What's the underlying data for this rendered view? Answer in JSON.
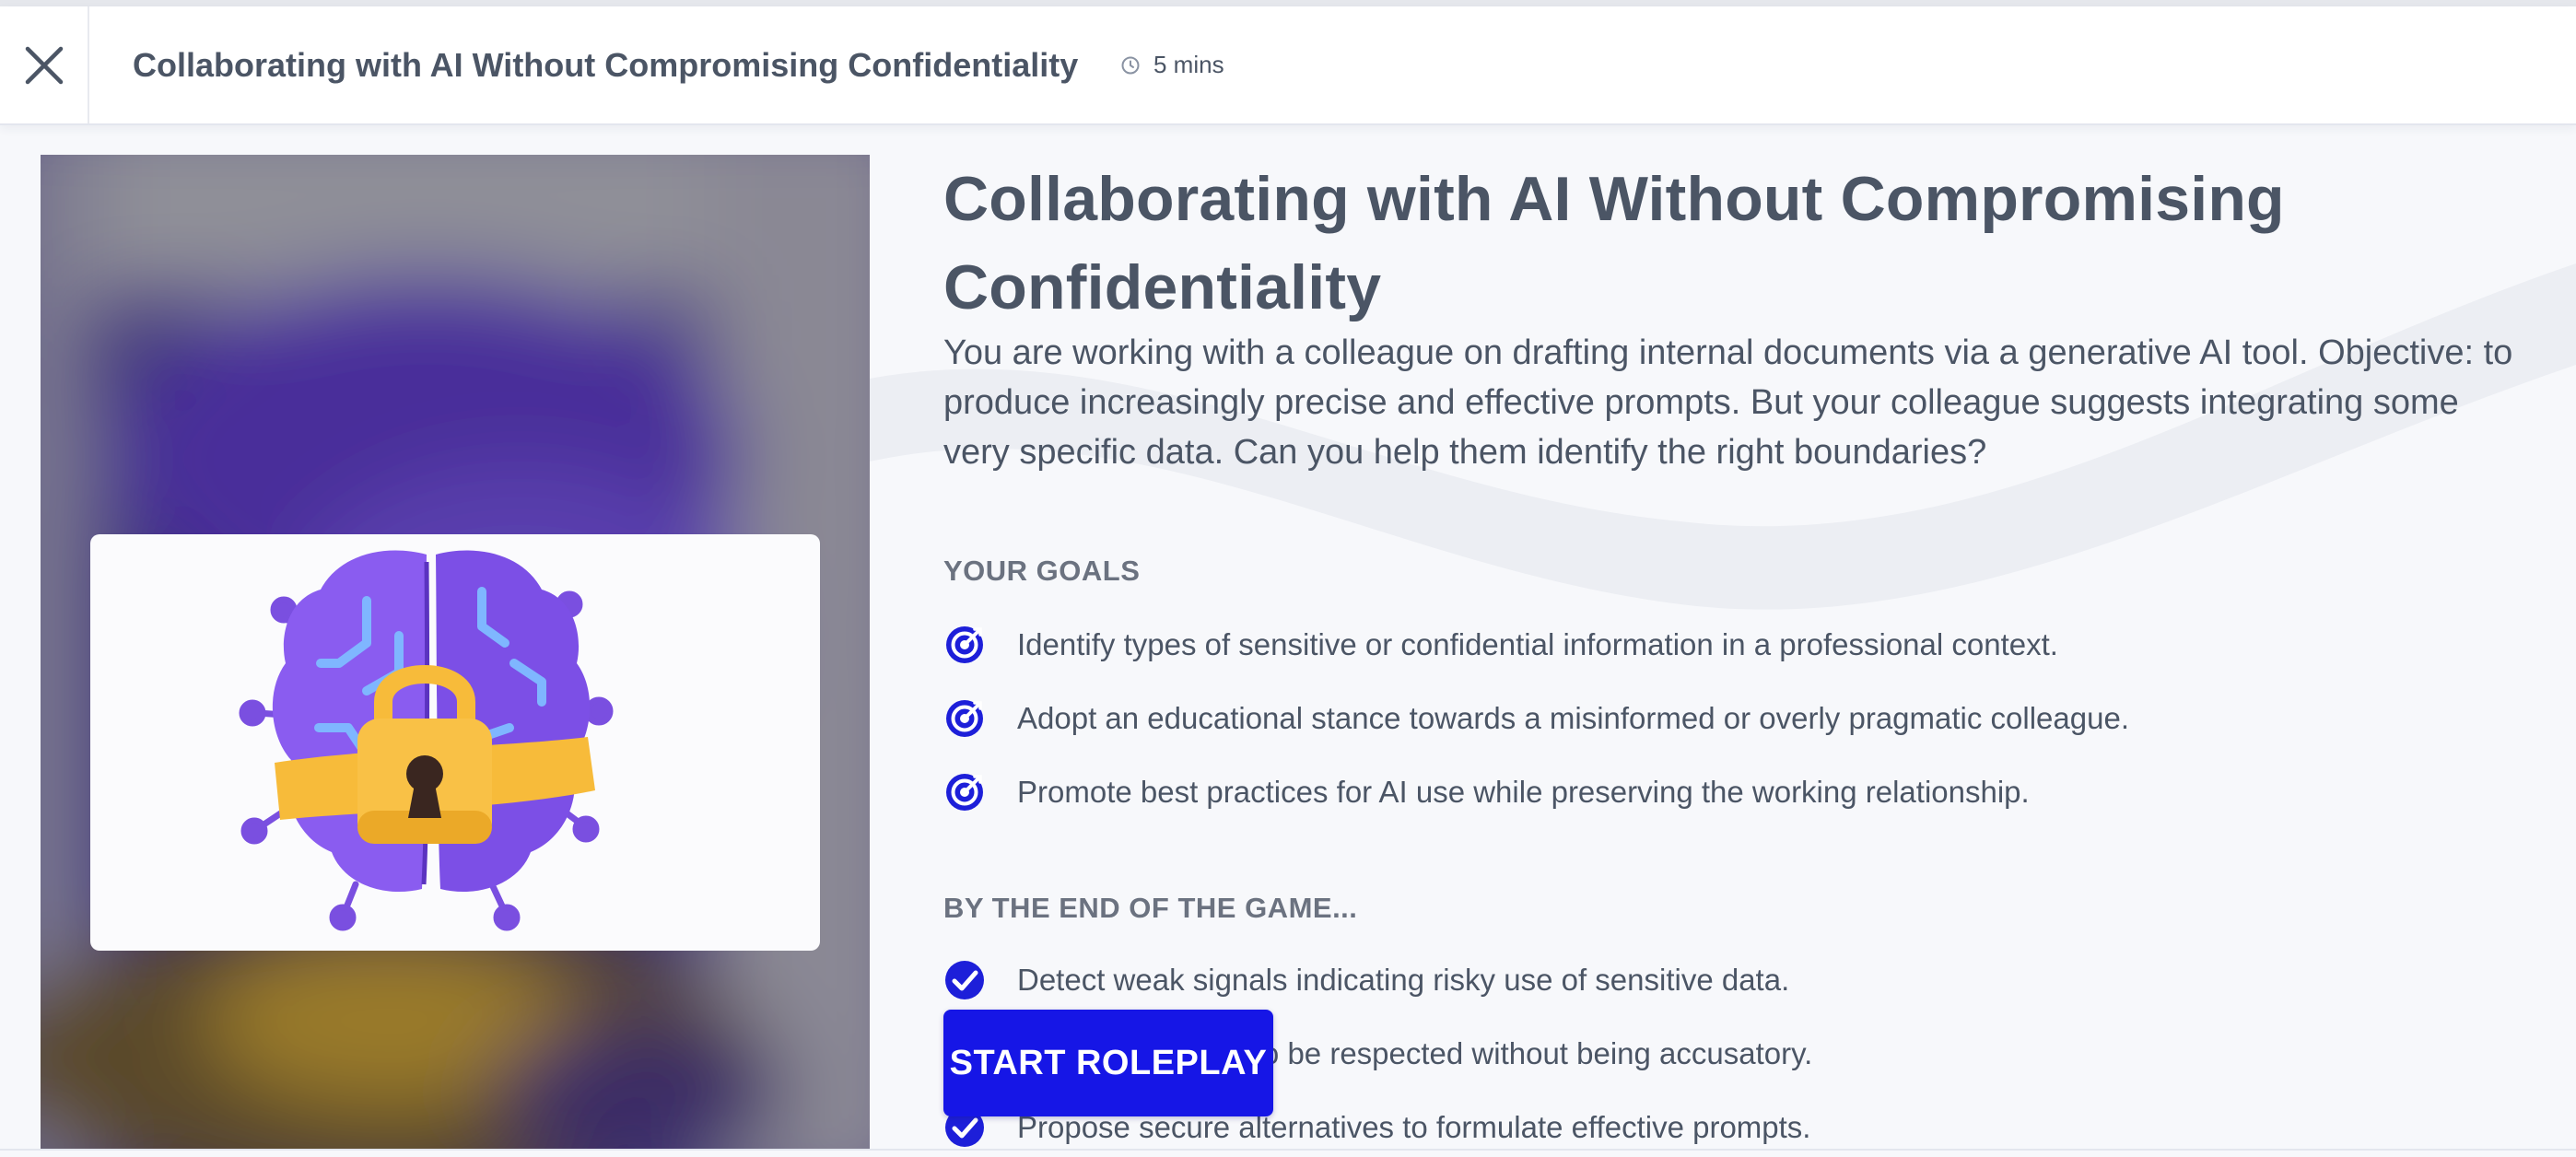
{
  "header": {
    "title": "Collaborating with AI Without Compromising Confidentiality",
    "duration": "5 mins",
    "close_icon": "close-icon",
    "clock_icon": "clock-icon"
  },
  "main": {
    "title": "Collaborating with AI Without Compromising Confidentiality",
    "description": "You are working with a colleague on drafting internal documents via a generative AI tool. Objective: to produce increasingly precise and effective prompts. But your colleague suggests integrating some very specific data. Can you help them identify the right boundaries?",
    "goals_heading": "YOUR GOALS",
    "goals": [
      "Identify types of sensitive or confidential information in a professional context.",
      "Adopt an educational stance towards a misinformed or overly pragmatic colleague.",
      "Promote best practices for AI use while preserving the working relationship."
    ],
    "outcomes_heading": "BY THE END OF THE GAME...",
    "outcomes": [
      "Detect weak signals indicating risky use of sensitive data.",
      "Explain the limits to be respected without being accusatory.",
      "Propose secure alternatives to formulate effective prompts."
    ],
    "start_button": "START ROLEPLAY"
  },
  "illustration": {
    "icon": "brain-lock-icon"
  },
  "colors": {
    "accent": "#1616e6",
    "text": "#4b5565",
    "brain": "#7b4ee0",
    "lock": "#f6b73c"
  }
}
